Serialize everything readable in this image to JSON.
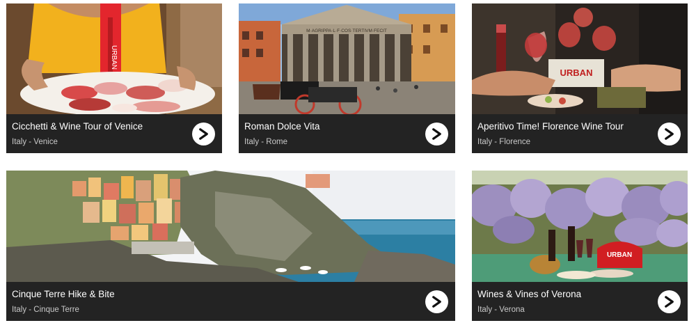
{
  "tours": [
    {
      "title": "Cicchetti & Wine Tour of Venice",
      "location": "Italy - Venice",
      "image": "venice-cicchetti-platter-photo"
    },
    {
      "title": "Roman Dolce Vita",
      "location": "Italy - Rome",
      "image": "rome-pantheon-photo"
    },
    {
      "title": "Aperitivo Time! Florence Wine Tour",
      "location": "Italy - Florence",
      "image": "florence-wine-toast-photo"
    },
    {
      "title": "Cinque Terre Hike & Bite",
      "location": "Italy - Cinque Terre",
      "image": "cinque-terre-coast-photo"
    },
    {
      "title": "Wines & Vines of Verona",
      "location": "Italy - Verona",
      "image": "verona-wisteria-wine-photo"
    }
  ],
  "arrow_icon": "chevron-right-circle-icon",
  "photo_text": {
    "lanyard": "URBAN",
    "pantheon_inscription": "M·AGRIPPA·L·F·COS·TERTIVM·FECIT",
    "florence_sign": "URBAN",
    "verona_bag": "URBAN"
  },
  "colors": {
    "caption_bg": "#232323",
    "title": "#ffffff",
    "location": "#c9c9c9"
  }
}
